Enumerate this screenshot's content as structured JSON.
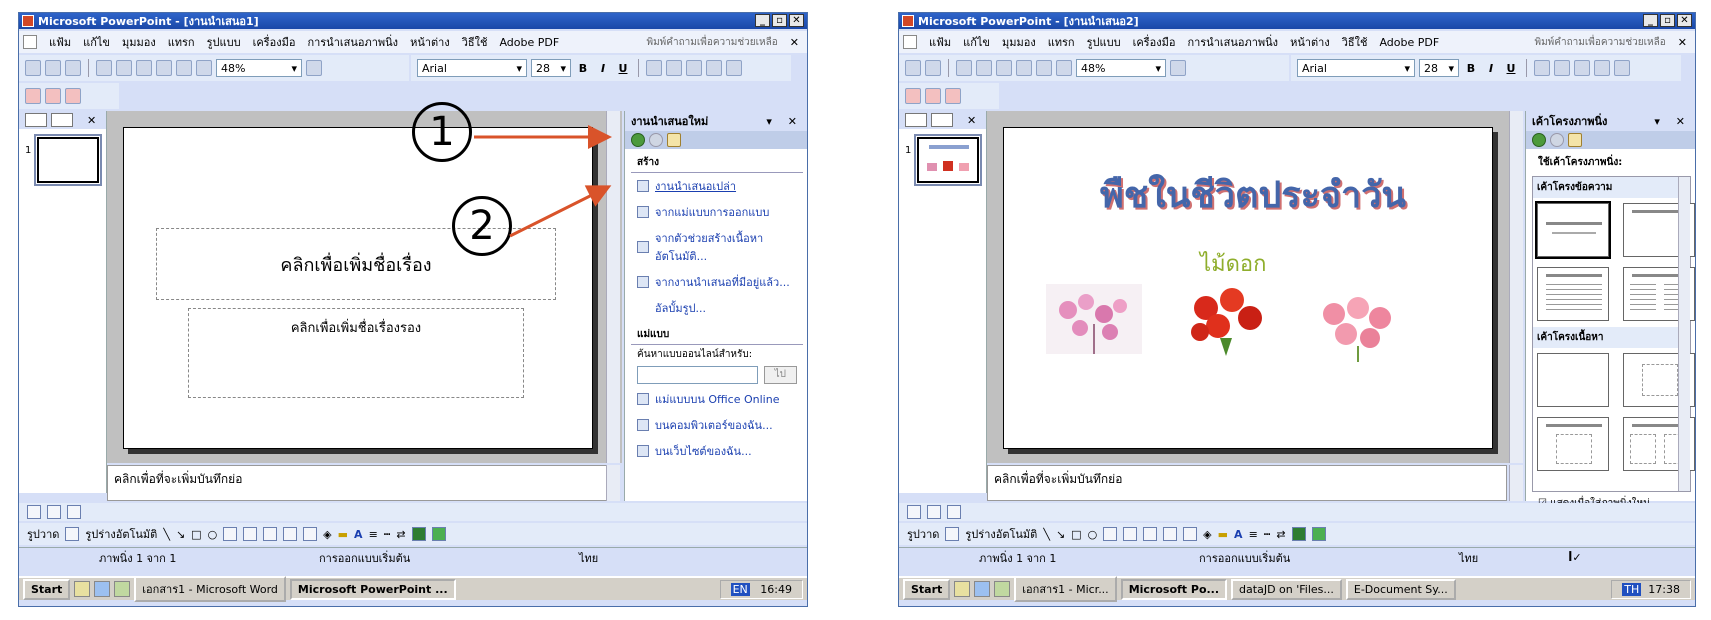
{
  "win1": {
    "title": "Microsoft PowerPoint - [งานนำเสนอ1]",
    "menu": [
      "แฟ้ม",
      "แก้ไข",
      "มุมมอง",
      "แทรก",
      "รูปแบบ",
      "เครื่องมือ",
      "การนำเสนอภาพนิ่ง",
      "หน้าต่าง",
      "วิธีใช้",
      "Adobe PDF"
    ],
    "help_placeholder": "พิมพ์คำถามเพื่อความช่วยเหลือ",
    "zoom": "48%",
    "font": "Arial",
    "font_size": "28",
    "thumb_number": "1",
    "title_placeholder": "คลิกเพื่อเพิ่มชื่อเรื่อง",
    "subtitle_placeholder": "คลิกเพื่อเพิ่มชื่อเรื่องรอง",
    "notes": "คลิกเพื่อที่จะเพิ่มบันทึกย่อ",
    "taskpane": {
      "title": "งานนำเสนอใหม่",
      "create_heading": "สร้าง",
      "create_items": [
        "งานนำเสนอเปล่า",
        "จากแม่แบบการออกแบบ",
        "จากตัวช่วยสร้างเนื้อหาอัตโนมัติ...",
        "จากงานนำเสนอที่มีอยู่แล้ว...",
        "อัลบั้มรูป..."
      ],
      "template_heading": "แม่แบบ",
      "search_label": "ค้นหาแบบออนไลน์สำหรับ:",
      "go": "ไป",
      "template_items": [
        "แม่แบบบน Office Online",
        "บนคอมพิวเตอร์ของฉัน...",
        "บนเว็บไซต์ของฉัน..."
      ]
    },
    "draw_label": "รูปวาด",
    "autoshape_label": "รูปร่างอัตโนมัติ",
    "status": [
      "ภาพนิ่ง 1 จาก 1",
      "การออกแบบเริ่มต้น",
      "ไทย"
    ],
    "taskbar": {
      "start": "Start",
      "tasks": [
        "เอกสาร1 - Microsoft Word",
        "Microsoft PowerPoint ..."
      ],
      "lang": "EN",
      "time": "16:49"
    },
    "callouts": [
      "1",
      "2"
    ]
  },
  "win2": {
    "title": "Microsoft PowerPoint - [งานนำเสนอ2]",
    "menu": [
      "แฟ้ม",
      "แก้ไข",
      "มุมมอง",
      "แทรก",
      "รูปแบบ",
      "เครื่องมือ",
      "การนำเสนอภาพนิ่ง",
      "หน้าต่าง",
      "วิธีใช้",
      "Adobe PDF"
    ],
    "help_placeholder": "พิมพ์คำถามเพื่อความช่วยเหลือ",
    "zoom": "48%",
    "font": "Arial",
    "font_size": "28",
    "thumb_number": "1",
    "slide_title": "พืชในชีวิตประจำวัน",
    "slide_subtitle": "ไม้ดอก",
    "notes": "คลิกเพื่อที่จะเพิ่มบันทึกย่อ",
    "taskpane": {
      "title": "เค้าโครงภาพนิ่ง",
      "apply_label": "ใช้เค้าโครงภาพนิ่ง:",
      "text_layouts": "เค้าโครงข้อความ",
      "content_layouts": "เค้าโครงเนื้อหา",
      "show_checkbox": "แสดงเมื่อใส่ภาพนิ่งใหม่"
    },
    "draw_label": "รูปวาด",
    "autoshape_label": "รูปร่างอัตโนมัติ",
    "status": [
      "ภาพนิ่ง 1 จาก 1",
      "การออกแบบเริ่มต้น",
      "ไทย"
    ],
    "taskbar": {
      "start": "Start",
      "tasks": [
        "เอกสาร1 - Micr...",
        "Microsoft Po...",
        "dataJD on 'Files...",
        "E-Document Sy..."
      ],
      "lang": "TH",
      "time": "17:38"
    }
  }
}
